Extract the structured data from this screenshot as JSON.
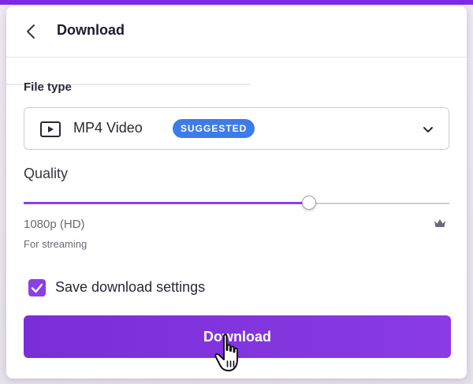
{
  "header": {
    "title": "Download",
    "back_icon": "chevron-left-icon"
  },
  "file_type": {
    "label": "File type",
    "selected": "MP4 Video",
    "badge": "SUGGESTED",
    "icon": "video-file-icon",
    "dropdown_icon": "chevron-down-icon"
  },
  "quality": {
    "label": "Quality",
    "slider_value": 0.67,
    "resolution": "1080p (HD)",
    "note": "For streaming",
    "premium_icon": "crown-icon"
  },
  "save_settings": {
    "label": "Save download settings",
    "checked": true
  },
  "download_button": {
    "label": "Download"
  },
  "colors": {
    "accent": "#8b3fe6",
    "button": "#7d2ae8",
    "badge": "#3d7bea",
    "cursor_icon": "hand-pointer-icon"
  }
}
